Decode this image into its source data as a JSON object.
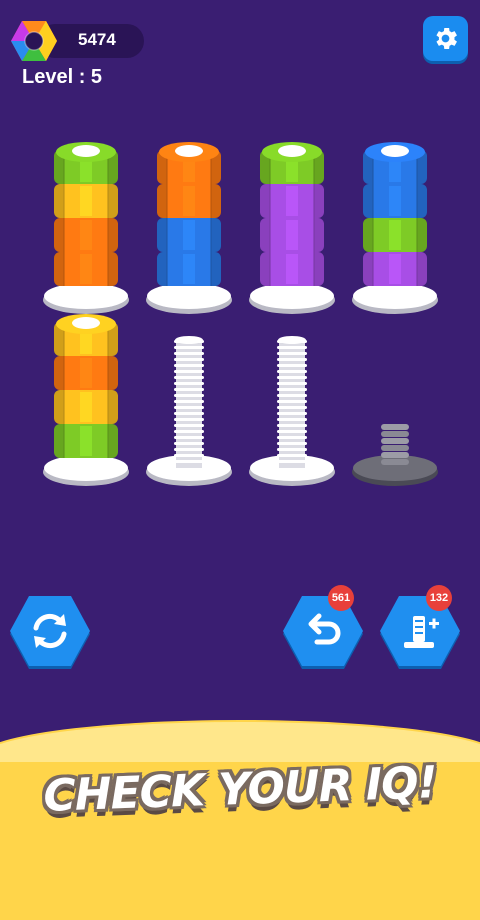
{
  "header": {
    "coins": "5474",
    "level_text": "Level : 5",
    "settings_icon": "gear-icon",
    "logo_icon": "rainbow-hex-nut-icon"
  },
  "board": {
    "rows": [
      [
        {
          "nuts": [
            "orange",
            "orange",
            "yellow",
            "green"
          ],
          "full": true
        },
        {
          "nuts": [
            "blue",
            "blue",
            "orange",
            "orange"
          ],
          "full": true
        },
        {
          "nuts": [
            "purple",
            "purple",
            "purple",
            "green"
          ],
          "full": true
        },
        {
          "nuts": [
            "purple",
            "green",
            "blue",
            "blue"
          ],
          "full": true
        }
      ],
      [
        {
          "nuts": [
            "green",
            "yellow",
            "orange",
            "yellow"
          ],
          "full": true
        },
        {
          "nuts": [],
          "full": false,
          "type": "empty-bolt"
        },
        {
          "nuts": [],
          "full": false,
          "type": "empty-bolt"
        },
        {
          "nuts": [],
          "full": false,
          "type": "locked-bolt"
        }
      ]
    ],
    "colors": {
      "orange": "#ff7a12",
      "yellow": "#ffc21f",
      "green": "#7ecb26",
      "blue": "#2979e8",
      "purple": "#a84ee6"
    }
  },
  "controls": {
    "shuffle_icon": "refresh-icon",
    "undo_icon": "undo-icon",
    "undo_count": "561",
    "add_bolt_icon": "add-bolt-icon",
    "add_bolt_count": "132"
  },
  "banner": {
    "headline": "CHECK YOUR IQ!"
  }
}
